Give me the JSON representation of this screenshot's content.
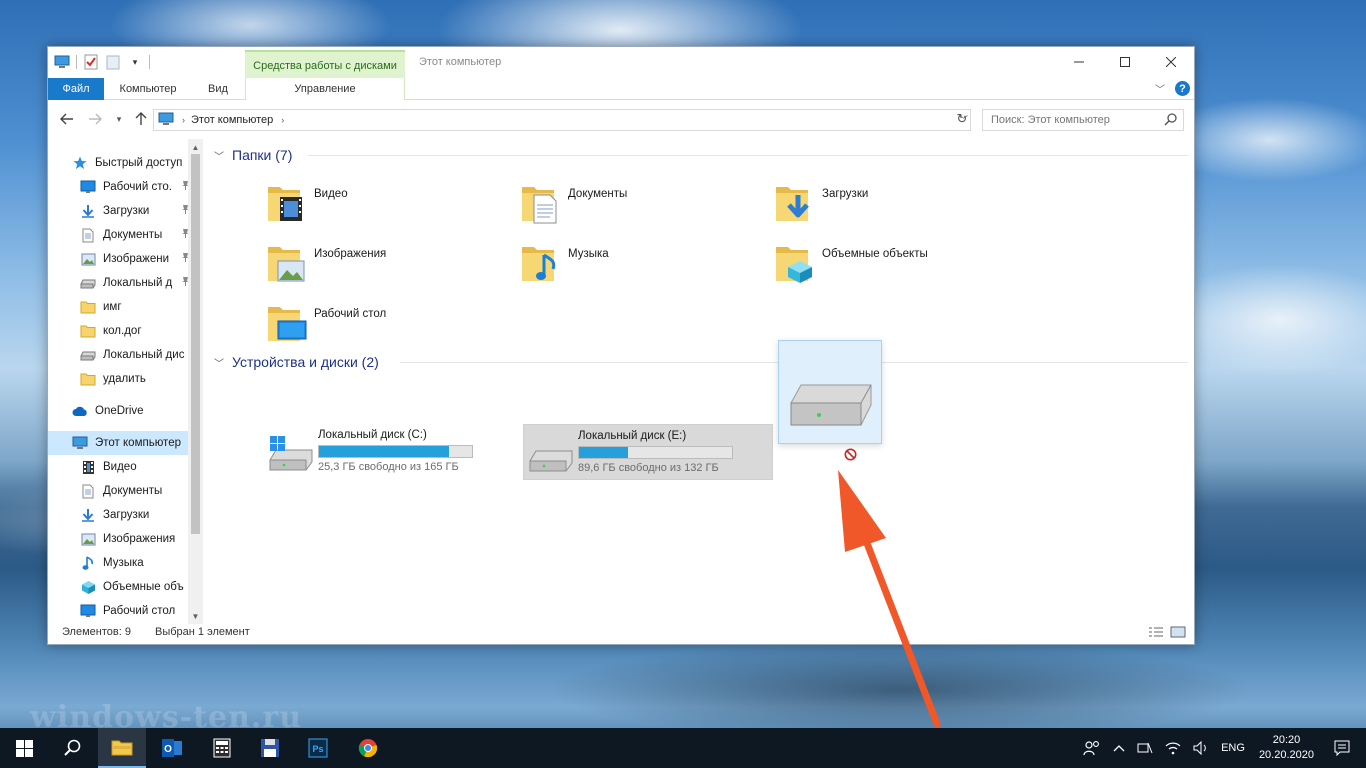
{
  "window": {
    "title": "Этот компьютер",
    "context_tab_header": "Средства работы с дисками",
    "tabs": {
      "file": "Файл",
      "computer": "Компьютер",
      "view": "Вид",
      "manage": "Управление"
    }
  },
  "address": {
    "crumb": "Этот компьютер",
    "search_placeholder": "Поиск: Этот компьютер"
  },
  "sidebar": {
    "items": [
      {
        "label": "Быстрый доступ",
        "icon": "star-icon"
      },
      {
        "label": "Рабочий сто.",
        "icon": "desktop-icon",
        "pinned": true
      },
      {
        "label": "Загрузки",
        "icon": "download-icon",
        "pinned": true
      },
      {
        "label": "Документы",
        "icon": "document-icon",
        "pinned": true
      },
      {
        "label": "Изображени",
        "icon": "pictures-icon",
        "pinned": true
      },
      {
        "label": "Локальный д",
        "icon": "drive-icon",
        "pinned": true
      },
      {
        "label": "имг",
        "icon": "folder-icon"
      },
      {
        "label": "кол.дог",
        "icon": "folder-icon"
      },
      {
        "label": "Локальный дис",
        "icon": "drive-icon"
      },
      {
        "label": "удалить",
        "icon": "folder-icon"
      },
      {
        "label": "OneDrive",
        "icon": "cloud-icon"
      },
      {
        "label": "Этот компьютер",
        "icon": "computer-icon"
      },
      {
        "label": "Видео",
        "icon": "video-icon"
      },
      {
        "label": "Документы",
        "icon": "document-icon"
      },
      {
        "label": "Загрузки",
        "icon": "download-icon"
      },
      {
        "label": "Изображения",
        "icon": "pictures-icon"
      },
      {
        "label": "Музыка",
        "icon": "music-icon"
      },
      {
        "label": "Объемные объ",
        "icon": "3d-objects-icon"
      },
      {
        "label": "Рабочий стол",
        "icon": "desktop-icon"
      }
    ]
  },
  "folders": {
    "header": "Папки (7)",
    "items": [
      {
        "label": "Видео"
      },
      {
        "label": "Документы"
      },
      {
        "label": "Загрузки"
      },
      {
        "label": "Изображения"
      },
      {
        "label": "Музыка"
      },
      {
        "label": "Объемные объекты"
      },
      {
        "label": "Рабочий стол"
      }
    ]
  },
  "devices": {
    "header": "Устройства и диски (2)",
    "items": [
      {
        "name": "Локальный диск (C:)",
        "free": "25,3 ГБ свободно из 165 ГБ",
        "used_fraction": 0.847
      },
      {
        "name": "Локальный диск (E:)",
        "free": "89,6 ГБ свободно из 132 ГБ",
        "used_fraction": 0.321
      }
    ]
  },
  "status": {
    "count": "Элементов: 9",
    "selection": "Выбран 1 элемент"
  },
  "taskbar": {
    "lang": "ENG",
    "time": "20:20",
    "date": "20.20.2020"
  },
  "watermark": "windows-ten.ru",
  "colors": {
    "accent": "#1979ca",
    "selection": "#cce8ff",
    "drive_fill": "#26a0da",
    "annotation_arrow": "#f0582a"
  }
}
